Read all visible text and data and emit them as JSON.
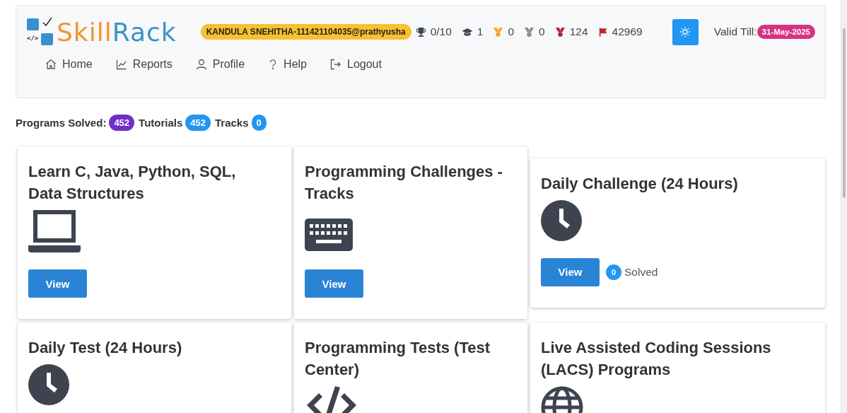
{
  "logo": {
    "code_mark": "</>",
    "word_first": "Skill",
    "word_second": "Rack"
  },
  "user_badge": "KANDULA SNEHITHA-111421104035@prathyusha",
  "stats": [
    {
      "kind": "trophy",
      "value": "0/10"
    },
    {
      "kind": "cap",
      "value": "1"
    },
    {
      "kind": "gold-medal",
      "value": "0"
    },
    {
      "kind": "silver-medal",
      "value": "0"
    },
    {
      "kind": "red-medal",
      "value": "124"
    },
    {
      "kind": "flag",
      "value": "42969"
    }
  ],
  "valid_till": {
    "label": "Valid Till:",
    "date": "31-May-2025"
  },
  "nav": [
    {
      "kind": "home",
      "label": "Home"
    },
    {
      "kind": "reports",
      "label": "Reports"
    },
    {
      "kind": "profile",
      "label": "Profile"
    },
    {
      "kind": "help",
      "label": "Help"
    },
    {
      "kind": "logout",
      "label": "Logout"
    }
  ],
  "summary": [
    {
      "label": "Programs Solved:",
      "count": "452",
      "color": "#6f2fc9"
    },
    {
      "label": "Tutorials",
      "count": "452",
      "color": "#2196f3"
    },
    {
      "label": "Tracks",
      "count": "0",
      "color": "#2196f3"
    }
  ],
  "cards": [
    {
      "title": "Learn C, Java, Python, SQL, Data Structures",
      "kind": "laptop",
      "button": "View"
    },
    {
      "title": "Programming Challenges - Tracks",
      "kind": "keyboard",
      "button": "View"
    },
    {
      "title": "Daily Challenge (24 Hours)",
      "kind": "clock",
      "button": "View",
      "solved_count": "0",
      "solved_label": "Solved"
    },
    {
      "title": "Daily Test (24 Hours)",
      "kind": "clock"
    },
    {
      "title": "Programming Tests (Test Center)",
      "kind": "code"
    },
    {
      "title": "Live Assisted Coding Sessions (LACS) Programs",
      "kind": "globe"
    }
  ]
}
